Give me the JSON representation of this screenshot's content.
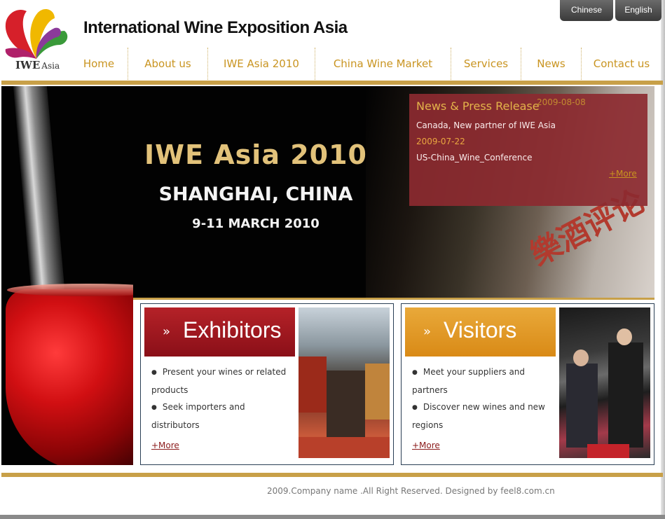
{
  "header": {
    "logo_text": "IWE",
    "logo_subtext": "Asia",
    "title": "International Wine Exposition Asia"
  },
  "languages": [
    "Chinese",
    "English"
  ],
  "nav": {
    "items": [
      "Home",
      "About us",
      "IWE Asia 2010",
      "China Wine Market",
      "Services",
      "News",
      "Contact us"
    ]
  },
  "banner": {
    "headline": "IWE Asia 2010",
    "location": "SHANGHAI, CHINA",
    "dates": "9-11 MARCH 2010",
    "magazine_text": "樂酒评论"
  },
  "news": {
    "heading": "News & Press Release",
    "items": [
      {
        "date": "2009-08-08",
        "title": "Canada, New partner of IWE Asia"
      },
      {
        "date": "2009-07-22",
        "title": "US-China_Wine_Conference"
      }
    ],
    "more": "+More"
  },
  "cards": {
    "exhibitors": {
      "title": "Exhibitors",
      "arrow": "»",
      "bullets": [
        "Present your wines or related products",
        "Seek importers and distributors"
      ],
      "more": "+More"
    },
    "visitors": {
      "title": "Visitors",
      "arrow": "»",
      "bullets": [
        "Meet your suppliers and partners",
        "Discover new wines and new regions"
      ],
      "more": "+More"
    }
  },
  "footer": {
    "copyright": "2009.Company name .All Right Reserved. Designed by feel8.com.cn"
  },
  "colors": {
    "gold": "#c8a048",
    "nav_text": "#c99420",
    "news_panel": "#8c2a30",
    "exhibitors_header": "#a3161e",
    "visitors_header": "#e09a26"
  }
}
